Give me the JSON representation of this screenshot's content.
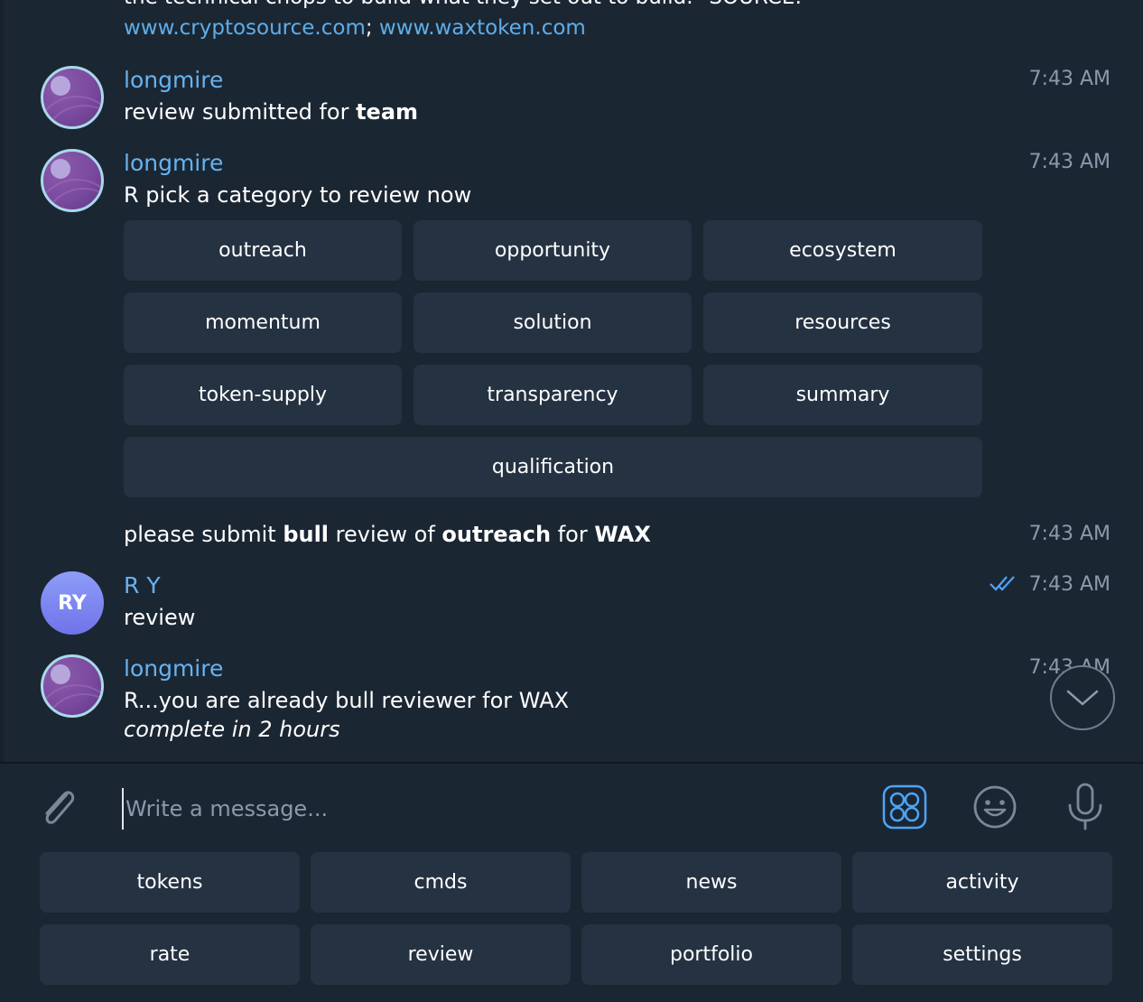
{
  "messages": {
    "top_text": "the technical chops to build what they set out to build.\" SOURCE:",
    "link1": "www.cryptosource.com",
    "link_separator": ";",
    "link2": "www.waxtoken.com",
    "msg1": {
      "sender": "longmire",
      "text_prefix": "review submitted for ",
      "text_bold": "team",
      "time": "7:43 AM"
    },
    "msg2": {
      "sender": "longmire",
      "text": "R pick a category to review now",
      "time": "7:43 AM"
    },
    "msg3": {
      "parts": [
        "please submit ",
        "bull",
        " review of ",
        "outreach",
        " for ",
        "WAX"
      ],
      "time": "7:43 AM"
    },
    "msg4": {
      "sender": "R Y",
      "avatar_initials": "RY",
      "text": "review",
      "time": "7:43 AM"
    },
    "msg5": {
      "sender": "longmire",
      "text": "R...you are already bull reviewer for WAX",
      "text_italic": "complete in 2 hours",
      "time": "7:43 AM"
    }
  },
  "inline_keyboard": [
    "outreach",
    "opportunity",
    "ecosystem",
    "momentum",
    "solution",
    "resources",
    "token-supply",
    "transparency",
    "summary",
    "qualification"
  ],
  "composer": {
    "placeholder": "Write a message..."
  },
  "reply_keyboard": [
    "tokens",
    "cmds",
    "news",
    "activity",
    "rate",
    "review",
    "portfolio",
    "settings"
  ],
  "icons": {
    "attach": "paperclip-icon",
    "commands": "bot-commands-icon",
    "emoji": "emoji-icon",
    "mic": "microphone-icon",
    "scroll": "chevron-down-icon",
    "read": "double-check-icon"
  },
  "colors": {
    "background": "#1b2633",
    "button": "#243242",
    "link": "#5eaee9",
    "sender": "#66b3f0",
    "timestamp": "#8a9aab",
    "accent": "#4ea4f6"
  }
}
